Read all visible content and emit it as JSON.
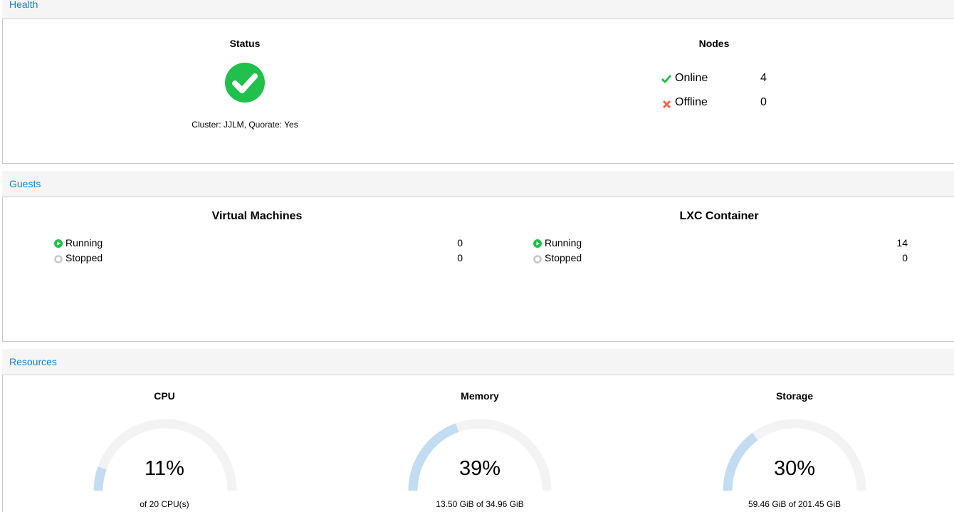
{
  "health": {
    "title": "Health",
    "status_heading": "Status",
    "status_icon": "check-circle-icon",
    "status_color": "#21bf4b",
    "cluster_text": "Cluster: JJLM, Quorate: Yes",
    "nodes_heading": "Nodes",
    "nodes": [
      {
        "label": "Online",
        "count": "4",
        "icon": "check-icon",
        "color": "#21bf4b"
      },
      {
        "label": "Offline",
        "count": "0",
        "icon": "x-icon",
        "color": "#f2694b"
      }
    ]
  },
  "guests": {
    "title": "Guests",
    "vm": {
      "heading": "Virtual Machines",
      "rows": [
        {
          "label": "Running",
          "count": "0",
          "icon": "play-circle-icon"
        },
        {
          "label": "Stopped",
          "count": "0",
          "icon": "stop-circle-icon"
        }
      ]
    },
    "lxc": {
      "heading": "LXC Container",
      "rows": [
        {
          "label": "Running",
          "count": "14",
          "icon": "play-circle-icon"
        },
        {
          "label": "Stopped",
          "count": "0",
          "icon": "stop-circle-icon"
        }
      ]
    }
  },
  "resources": {
    "title": "Resources",
    "gauges": [
      {
        "label": "CPU",
        "percent": 11,
        "percent_text": "11%",
        "detail": "of 20 CPU(s)"
      },
      {
        "label": "Memory",
        "percent": 39,
        "percent_text": "39%",
        "detail": "13.50 GiB of 34.96 GiB"
      },
      {
        "label": "Storage",
        "percent": 30,
        "percent_text": "30%",
        "detail": "59.46 GiB of 201.45 GiB"
      }
    ],
    "gauge_track_color": "#f3f3f3",
    "gauge_fill_color": "#c2ddf2"
  }
}
